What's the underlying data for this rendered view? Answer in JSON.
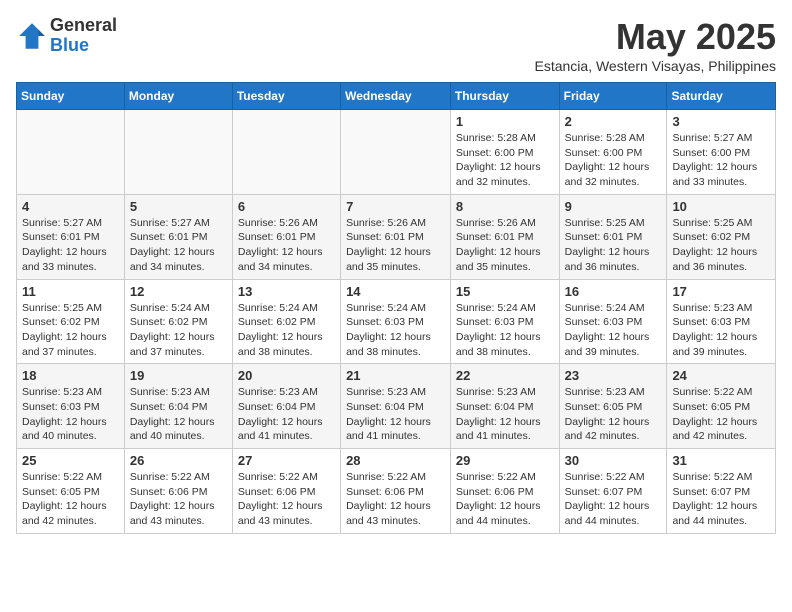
{
  "logo": {
    "general": "General",
    "blue": "Blue"
  },
  "title": "May 2025",
  "location": "Estancia, Western Visayas, Philippines",
  "days_header": [
    "Sunday",
    "Monday",
    "Tuesday",
    "Wednesday",
    "Thursday",
    "Friday",
    "Saturday"
  ],
  "weeks": [
    [
      {
        "day": "",
        "info": ""
      },
      {
        "day": "",
        "info": ""
      },
      {
        "day": "",
        "info": ""
      },
      {
        "day": "",
        "info": ""
      },
      {
        "day": "1",
        "info": "Sunrise: 5:28 AM\nSunset: 6:00 PM\nDaylight: 12 hours\nand 32 minutes."
      },
      {
        "day": "2",
        "info": "Sunrise: 5:28 AM\nSunset: 6:00 PM\nDaylight: 12 hours\nand 32 minutes."
      },
      {
        "day": "3",
        "info": "Sunrise: 5:27 AM\nSunset: 6:00 PM\nDaylight: 12 hours\nand 33 minutes."
      }
    ],
    [
      {
        "day": "4",
        "info": "Sunrise: 5:27 AM\nSunset: 6:01 PM\nDaylight: 12 hours\nand 33 minutes."
      },
      {
        "day": "5",
        "info": "Sunrise: 5:27 AM\nSunset: 6:01 PM\nDaylight: 12 hours\nand 34 minutes."
      },
      {
        "day": "6",
        "info": "Sunrise: 5:26 AM\nSunset: 6:01 PM\nDaylight: 12 hours\nand 34 minutes."
      },
      {
        "day": "7",
        "info": "Sunrise: 5:26 AM\nSunset: 6:01 PM\nDaylight: 12 hours\nand 35 minutes."
      },
      {
        "day": "8",
        "info": "Sunrise: 5:26 AM\nSunset: 6:01 PM\nDaylight: 12 hours\nand 35 minutes."
      },
      {
        "day": "9",
        "info": "Sunrise: 5:25 AM\nSunset: 6:01 PM\nDaylight: 12 hours\nand 36 minutes."
      },
      {
        "day": "10",
        "info": "Sunrise: 5:25 AM\nSunset: 6:02 PM\nDaylight: 12 hours\nand 36 minutes."
      }
    ],
    [
      {
        "day": "11",
        "info": "Sunrise: 5:25 AM\nSunset: 6:02 PM\nDaylight: 12 hours\nand 37 minutes."
      },
      {
        "day": "12",
        "info": "Sunrise: 5:24 AM\nSunset: 6:02 PM\nDaylight: 12 hours\nand 37 minutes."
      },
      {
        "day": "13",
        "info": "Sunrise: 5:24 AM\nSunset: 6:02 PM\nDaylight: 12 hours\nand 38 minutes."
      },
      {
        "day": "14",
        "info": "Sunrise: 5:24 AM\nSunset: 6:03 PM\nDaylight: 12 hours\nand 38 minutes."
      },
      {
        "day": "15",
        "info": "Sunrise: 5:24 AM\nSunset: 6:03 PM\nDaylight: 12 hours\nand 38 minutes."
      },
      {
        "day": "16",
        "info": "Sunrise: 5:24 AM\nSunset: 6:03 PM\nDaylight: 12 hours\nand 39 minutes."
      },
      {
        "day": "17",
        "info": "Sunrise: 5:23 AM\nSunset: 6:03 PM\nDaylight: 12 hours\nand 39 minutes."
      }
    ],
    [
      {
        "day": "18",
        "info": "Sunrise: 5:23 AM\nSunset: 6:03 PM\nDaylight: 12 hours\nand 40 minutes."
      },
      {
        "day": "19",
        "info": "Sunrise: 5:23 AM\nSunset: 6:04 PM\nDaylight: 12 hours\nand 40 minutes."
      },
      {
        "day": "20",
        "info": "Sunrise: 5:23 AM\nSunset: 6:04 PM\nDaylight: 12 hours\nand 41 minutes."
      },
      {
        "day": "21",
        "info": "Sunrise: 5:23 AM\nSunset: 6:04 PM\nDaylight: 12 hours\nand 41 minutes."
      },
      {
        "day": "22",
        "info": "Sunrise: 5:23 AM\nSunset: 6:04 PM\nDaylight: 12 hours\nand 41 minutes."
      },
      {
        "day": "23",
        "info": "Sunrise: 5:23 AM\nSunset: 6:05 PM\nDaylight: 12 hours\nand 42 minutes."
      },
      {
        "day": "24",
        "info": "Sunrise: 5:22 AM\nSunset: 6:05 PM\nDaylight: 12 hours\nand 42 minutes."
      }
    ],
    [
      {
        "day": "25",
        "info": "Sunrise: 5:22 AM\nSunset: 6:05 PM\nDaylight: 12 hours\nand 42 minutes."
      },
      {
        "day": "26",
        "info": "Sunrise: 5:22 AM\nSunset: 6:06 PM\nDaylight: 12 hours\nand 43 minutes."
      },
      {
        "day": "27",
        "info": "Sunrise: 5:22 AM\nSunset: 6:06 PM\nDaylight: 12 hours\nand 43 minutes."
      },
      {
        "day": "28",
        "info": "Sunrise: 5:22 AM\nSunset: 6:06 PM\nDaylight: 12 hours\nand 43 minutes."
      },
      {
        "day": "29",
        "info": "Sunrise: 5:22 AM\nSunset: 6:06 PM\nDaylight: 12 hours\nand 44 minutes."
      },
      {
        "day": "30",
        "info": "Sunrise: 5:22 AM\nSunset: 6:07 PM\nDaylight: 12 hours\nand 44 minutes."
      },
      {
        "day": "31",
        "info": "Sunrise: 5:22 AM\nSunset: 6:07 PM\nDaylight: 12 hours\nand 44 minutes."
      }
    ]
  ]
}
